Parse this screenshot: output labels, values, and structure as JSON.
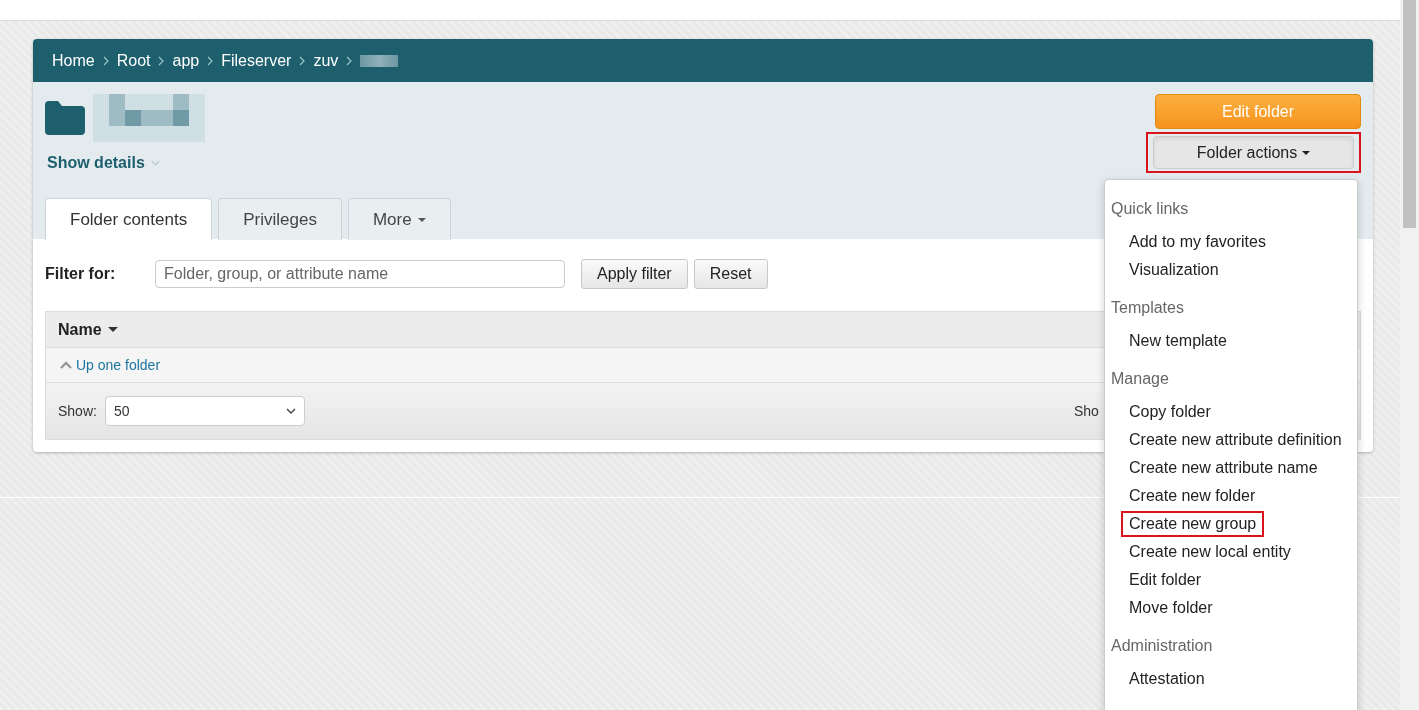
{
  "breadcrumb": [
    {
      "kind": "link",
      "label": "Home"
    },
    {
      "kind": "link",
      "label": "Root"
    },
    {
      "kind": "link",
      "label": "app"
    },
    {
      "kind": "link",
      "label": "Fileserver"
    },
    {
      "kind": "link",
      "label": "zuv"
    },
    {
      "kind": "redacted"
    }
  ],
  "folder": {
    "name_redacted": true,
    "show_details": "Show details"
  },
  "actions": {
    "edit": "Edit folder",
    "menu_button": {
      "label": "Folder actions",
      "highlighted": true,
      "expanded": true
    }
  },
  "tabs": [
    {
      "label": "Folder contents",
      "selected": true,
      "dropdown": false
    },
    {
      "label": "Privileges",
      "selected": false,
      "dropdown": false
    },
    {
      "label": "More",
      "selected": false,
      "dropdown": true
    }
  ],
  "filter": {
    "label": "Filter for:",
    "placeholder": "Folder, group, or attribute name",
    "apply": "Apply filter",
    "reset": "Reset"
  },
  "table": {
    "column": "Name",
    "up_link": "Up one folder",
    "show_label": "Show:",
    "page_size": "50",
    "covered_text": "Sho"
  },
  "menu": [
    {
      "heading": "Quick links",
      "items": [
        {
          "label": "Add to my favorites",
          "highlighted": false
        },
        {
          "label": "Visualization",
          "highlighted": false
        }
      ]
    },
    {
      "heading": "Templates",
      "items": [
        {
          "label": "New template",
          "highlighted": false
        }
      ]
    },
    {
      "heading": "Manage",
      "items": [
        {
          "label": "Copy folder",
          "highlighted": false
        },
        {
          "label": "Create new attribute definition",
          "highlighted": false
        },
        {
          "label": "Create new attribute name",
          "highlighted": false
        },
        {
          "label": "Create new folder",
          "highlighted": false
        },
        {
          "label": "Create new group",
          "highlighted": true
        },
        {
          "label": "Create new local entity",
          "highlighted": false
        },
        {
          "label": "Edit folder",
          "highlighted": false
        },
        {
          "label": "Move folder",
          "highlighted": false
        }
      ]
    },
    {
      "heading": "Administration",
      "items": [
        {
          "label": "Attestation",
          "highlighted": false
        }
      ]
    }
  ]
}
